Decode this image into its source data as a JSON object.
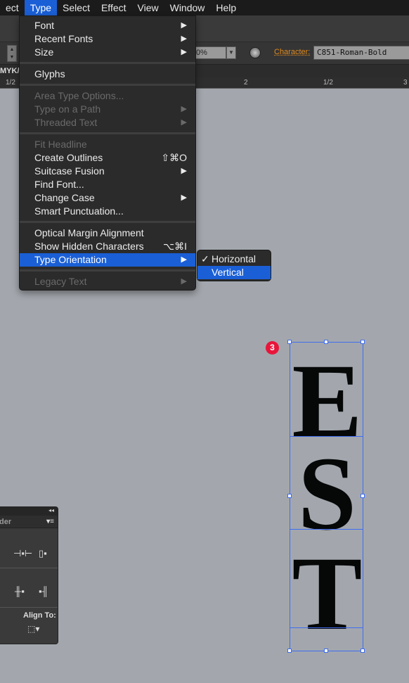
{
  "menubar": [
    "ect",
    "Type",
    "Select",
    "Effect",
    "View",
    "Window",
    "Help"
  ],
  "menubar_active": 1,
  "toolbar": {
    "percent": "0%",
    "character_label": "Character:",
    "font_name": "C851-Roman-Bold"
  },
  "docbar": {
    "text": "MYK/"
  },
  "ruler": {
    "ticks": [
      "1/2",
      "2",
      "1/2",
      "3"
    ]
  },
  "type_menu": [
    {
      "label": "Font",
      "submenu": true
    },
    {
      "label": "Recent Fonts",
      "submenu": true
    },
    {
      "label": "Size",
      "submenu": true
    },
    {
      "sep": true
    },
    {
      "label": "Glyphs"
    },
    {
      "sep": true
    },
    {
      "label": "Area Type Options...",
      "disabled": true
    },
    {
      "label": "Type on a Path",
      "submenu": true,
      "disabled": true
    },
    {
      "label": "Threaded Text",
      "submenu": true,
      "disabled": true
    },
    {
      "sep": true
    },
    {
      "label": "Fit Headline",
      "disabled": true
    },
    {
      "label": "Create Outlines",
      "shortcut": "⇧⌘O"
    },
    {
      "label": "Suitcase Fusion",
      "submenu": true
    },
    {
      "label": "Find Font..."
    },
    {
      "label": "Change Case",
      "submenu": true
    },
    {
      "label": "Smart Punctuation..."
    },
    {
      "sep": true
    },
    {
      "label": "Optical Margin Alignment"
    },
    {
      "label": "Show Hidden Characters",
      "shortcut": "⌥⌘I"
    },
    {
      "label": "Type Orientation",
      "submenu": true,
      "highlighted": true
    },
    {
      "sep": true
    },
    {
      "label": "Legacy Text",
      "submenu": true,
      "disabled": true
    }
  ],
  "orientation_submenu": [
    {
      "label": "Horizontal",
      "checked": true
    },
    {
      "label": "Vertical",
      "highlighted": true
    }
  ],
  "align_panel": {
    "tab": "der",
    "align_to_label": "Align To:"
  },
  "canvas": {
    "letters": [
      "E",
      "S",
      "T"
    ],
    "badge": "3"
  },
  "colors": {
    "accent": "#1a5fd6",
    "selection": "#3f6cf0",
    "badge": "#e8153b",
    "canvas": "#a3a7ad",
    "character_label": "#e08a1e"
  }
}
